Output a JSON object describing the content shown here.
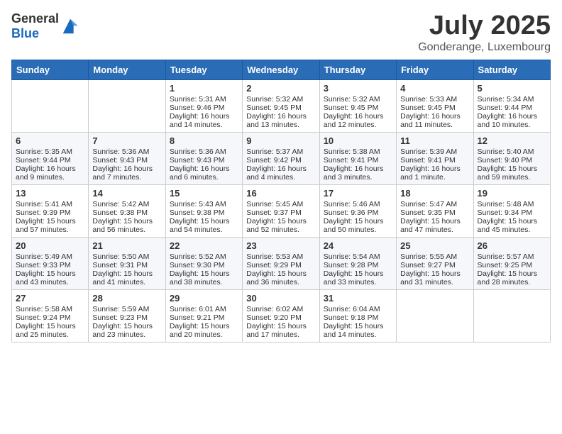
{
  "header": {
    "logo_general": "General",
    "logo_blue": "Blue",
    "month": "July 2025",
    "location": "Gonderange, Luxembourg"
  },
  "days_of_week": [
    "Sunday",
    "Monday",
    "Tuesday",
    "Wednesday",
    "Thursday",
    "Friday",
    "Saturday"
  ],
  "weeks": [
    [
      {
        "day": "",
        "sunrise": "",
        "sunset": "",
        "daylight": ""
      },
      {
        "day": "",
        "sunrise": "",
        "sunset": "",
        "daylight": ""
      },
      {
        "day": "1",
        "sunrise": "Sunrise: 5:31 AM",
        "sunset": "Sunset: 9:46 PM",
        "daylight": "Daylight: 16 hours and 14 minutes."
      },
      {
        "day": "2",
        "sunrise": "Sunrise: 5:32 AM",
        "sunset": "Sunset: 9:45 PM",
        "daylight": "Daylight: 16 hours and 13 minutes."
      },
      {
        "day": "3",
        "sunrise": "Sunrise: 5:32 AM",
        "sunset": "Sunset: 9:45 PM",
        "daylight": "Daylight: 16 hours and 12 minutes."
      },
      {
        "day": "4",
        "sunrise": "Sunrise: 5:33 AM",
        "sunset": "Sunset: 9:45 PM",
        "daylight": "Daylight: 16 hours and 11 minutes."
      },
      {
        "day": "5",
        "sunrise": "Sunrise: 5:34 AM",
        "sunset": "Sunset: 9:44 PM",
        "daylight": "Daylight: 16 hours and 10 minutes."
      }
    ],
    [
      {
        "day": "6",
        "sunrise": "Sunrise: 5:35 AM",
        "sunset": "Sunset: 9:44 PM",
        "daylight": "Daylight: 16 hours and 9 minutes."
      },
      {
        "day": "7",
        "sunrise": "Sunrise: 5:36 AM",
        "sunset": "Sunset: 9:43 PM",
        "daylight": "Daylight: 16 hours and 7 minutes."
      },
      {
        "day": "8",
        "sunrise": "Sunrise: 5:36 AM",
        "sunset": "Sunset: 9:43 PM",
        "daylight": "Daylight: 16 hours and 6 minutes."
      },
      {
        "day": "9",
        "sunrise": "Sunrise: 5:37 AM",
        "sunset": "Sunset: 9:42 PM",
        "daylight": "Daylight: 16 hours and 4 minutes."
      },
      {
        "day": "10",
        "sunrise": "Sunrise: 5:38 AM",
        "sunset": "Sunset: 9:41 PM",
        "daylight": "Daylight: 16 hours and 3 minutes."
      },
      {
        "day": "11",
        "sunrise": "Sunrise: 5:39 AM",
        "sunset": "Sunset: 9:41 PM",
        "daylight": "Daylight: 16 hours and 1 minute."
      },
      {
        "day": "12",
        "sunrise": "Sunrise: 5:40 AM",
        "sunset": "Sunset: 9:40 PM",
        "daylight": "Daylight: 15 hours and 59 minutes."
      }
    ],
    [
      {
        "day": "13",
        "sunrise": "Sunrise: 5:41 AM",
        "sunset": "Sunset: 9:39 PM",
        "daylight": "Daylight: 15 hours and 57 minutes."
      },
      {
        "day": "14",
        "sunrise": "Sunrise: 5:42 AM",
        "sunset": "Sunset: 9:38 PM",
        "daylight": "Daylight: 15 hours and 56 minutes."
      },
      {
        "day": "15",
        "sunrise": "Sunrise: 5:43 AM",
        "sunset": "Sunset: 9:38 PM",
        "daylight": "Daylight: 15 hours and 54 minutes."
      },
      {
        "day": "16",
        "sunrise": "Sunrise: 5:45 AM",
        "sunset": "Sunset: 9:37 PM",
        "daylight": "Daylight: 15 hours and 52 minutes."
      },
      {
        "day": "17",
        "sunrise": "Sunrise: 5:46 AM",
        "sunset": "Sunset: 9:36 PM",
        "daylight": "Daylight: 15 hours and 50 minutes."
      },
      {
        "day": "18",
        "sunrise": "Sunrise: 5:47 AM",
        "sunset": "Sunset: 9:35 PM",
        "daylight": "Daylight: 15 hours and 47 minutes."
      },
      {
        "day": "19",
        "sunrise": "Sunrise: 5:48 AM",
        "sunset": "Sunset: 9:34 PM",
        "daylight": "Daylight: 15 hours and 45 minutes."
      }
    ],
    [
      {
        "day": "20",
        "sunrise": "Sunrise: 5:49 AM",
        "sunset": "Sunset: 9:33 PM",
        "daylight": "Daylight: 15 hours and 43 minutes."
      },
      {
        "day": "21",
        "sunrise": "Sunrise: 5:50 AM",
        "sunset": "Sunset: 9:31 PM",
        "daylight": "Daylight: 15 hours and 41 minutes."
      },
      {
        "day": "22",
        "sunrise": "Sunrise: 5:52 AM",
        "sunset": "Sunset: 9:30 PM",
        "daylight": "Daylight: 15 hours and 38 minutes."
      },
      {
        "day": "23",
        "sunrise": "Sunrise: 5:53 AM",
        "sunset": "Sunset: 9:29 PM",
        "daylight": "Daylight: 15 hours and 36 minutes."
      },
      {
        "day": "24",
        "sunrise": "Sunrise: 5:54 AM",
        "sunset": "Sunset: 9:28 PM",
        "daylight": "Daylight: 15 hours and 33 minutes."
      },
      {
        "day": "25",
        "sunrise": "Sunrise: 5:55 AM",
        "sunset": "Sunset: 9:27 PM",
        "daylight": "Daylight: 15 hours and 31 minutes."
      },
      {
        "day": "26",
        "sunrise": "Sunrise: 5:57 AM",
        "sunset": "Sunset: 9:25 PM",
        "daylight": "Daylight: 15 hours and 28 minutes."
      }
    ],
    [
      {
        "day": "27",
        "sunrise": "Sunrise: 5:58 AM",
        "sunset": "Sunset: 9:24 PM",
        "daylight": "Daylight: 15 hours and 25 minutes."
      },
      {
        "day": "28",
        "sunrise": "Sunrise: 5:59 AM",
        "sunset": "Sunset: 9:23 PM",
        "daylight": "Daylight: 15 hours and 23 minutes."
      },
      {
        "day": "29",
        "sunrise": "Sunrise: 6:01 AM",
        "sunset": "Sunset: 9:21 PM",
        "daylight": "Daylight: 15 hours and 20 minutes."
      },
      {
        "day": "30",
        "sunrise": "Sunrise: 6:02 AM",
        "sunset": "Sunset: 9:20 PM",
        "daylight": "Daylight: 15 hours and 17 minutes."
      },
      {
        "day": "31",
        "sunrise": "Sunrise: 6:04 AM",
        "sunset": "Sunset: 9:18 PM",
        "daylight": "Daylight: 15 hours and 14 minutes."
      },
      {
        "day": "",
        "sunrise": "",
        "sunset": "",
        "daylight": ""
      },
      {
        "day": "",
        "sunrise": "",
        "sunset": "",
        "daylight": ""
      }
    ]
  ]
}
